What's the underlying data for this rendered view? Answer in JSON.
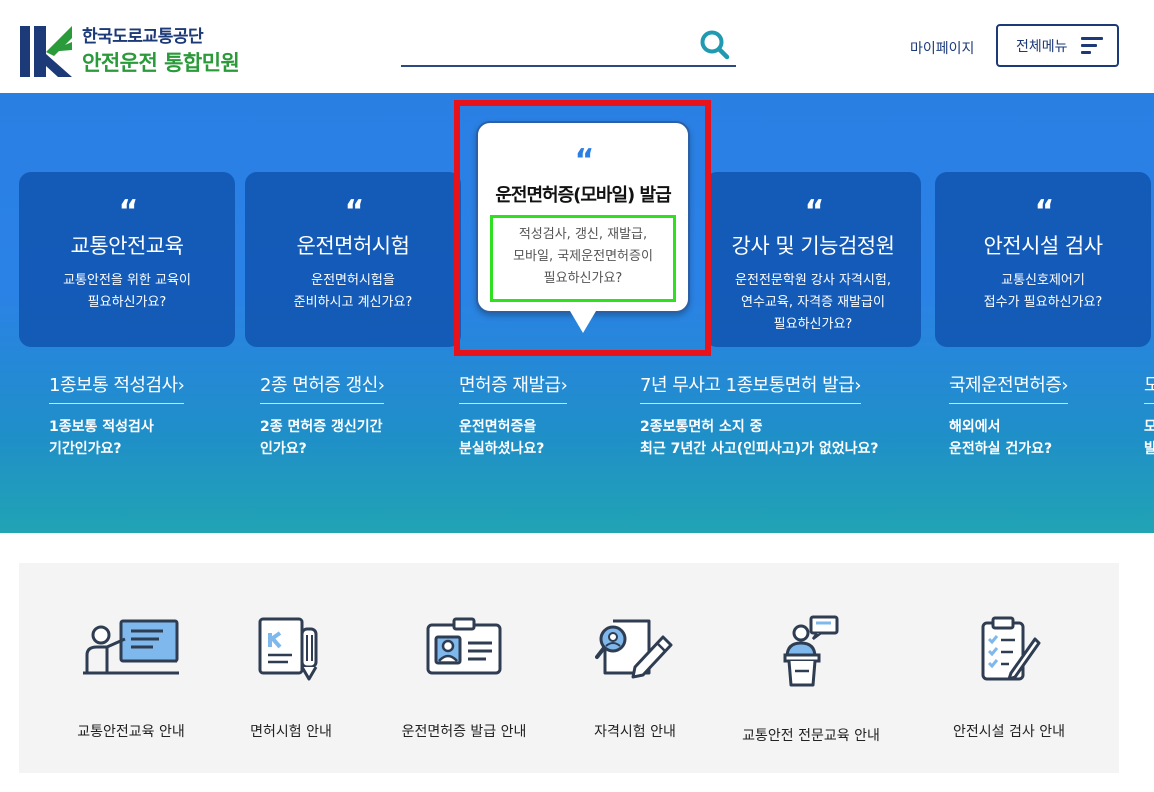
{
  "header": {
    "org_name": "한국도로교통공단",
    "site_name_1": "안전운전",
    "site_name_2": "통합민원",
    "search_placeholder": "",
    "mypage_label": "마이페이지",
    "menu_label": "전체메뉴"
  },
  "quote_mark": "“",
  "cards": [
    {
      "title": "교통안전교육",
      "desc_1": "교통안전을 위한 교육이",
      "desc_2": "필요하신가요?"
    },
    {
      "title": "운전면허시험",
      "desc_1": "운전면허시험을",
      "desc_2": "준비하시고 계신가요?"
    },
    {
      "title": "강사 및 기능검정원",
      "desc_1": "운전전문학원 강사 자격시험,",
      "desc_2": "연수교육, 자격증 재발급이",
      "desc_3": "필요하신가요?"
    },
    {
      "title": "안전시설 검사",
      "desc_1": "교통신호제어기",
      "desc_2": "접수가 필요하신가요?"
    }
  ],
  "popup": {
    "title": "운전면허증(모바일) 발급",
    "desc_1": "적성검사, 갱신, 재발급,",
    "desc_2": "모바일, 국제운전면허증이",
    "desc_3": "필요하신가요?"
  },
  "quick_links": [
    {
      "title": "1종보통 적성검사",
      "desc_1": "1종보통 적성검사",
      "desc_2": "기간인가요?"
    },
    {
      "title": "2종 면허증 갱신",
      "desc_1": "2종 면허증 갱신기간",
      "desc_2": "인가요?"
    },
    {
      "title": "면허증 재발급",
      "desc_1": "운전면허증을",
      "desc_2": "분실하셨나요?"
    },
    {
      "title": "7년 무사고 1종보통면허 발급",
      "desc_1": "2종보통면허 소지 중",
      "desc_2": "최근 7년간 사고(인피사고)가 없었나요?"
    },
    {
      "title": "국제운전면허증",
      "desc_1": "해외에서",
      "desc_2": "운전하실 건가요?"
    },
    {
      "title": "모",
      "desc_1": "모",
      "desc_2": "발"
    }
  ],
  "arrow": "›",
  "services": [
    {
      "label": "교통안전교육 안내",
      "icon": "presentation-teacher-icon"
    },
    {
      "label": "면허시험 안내",
      "icon": "exam-paper-pencil-icon"
    },
    {
      "label": "운전면허증 발급 안내",
      "icon": "id-card-icon"
    },
    {
      "label": "자격시험 안내",
      "icon": "document-search-pen-icon"
    },
    {
      "label": "교통안전 전문교육 안내",
      "icon": "lecturer-podium-icon"
    },
    {
      "label": "안전시설 검사 안내",
      "icon": "clipboard-checklist-icon"
    }
  ],
  "colors": {
    "brand_navy": "#1c3a78",
    "brand_green": "#2a9a3a",
    "hero_blue": "#2a7fe3",
    "highlight_red": "#e8131a",
    "highlight_green": "#2fe020"
  }
}
